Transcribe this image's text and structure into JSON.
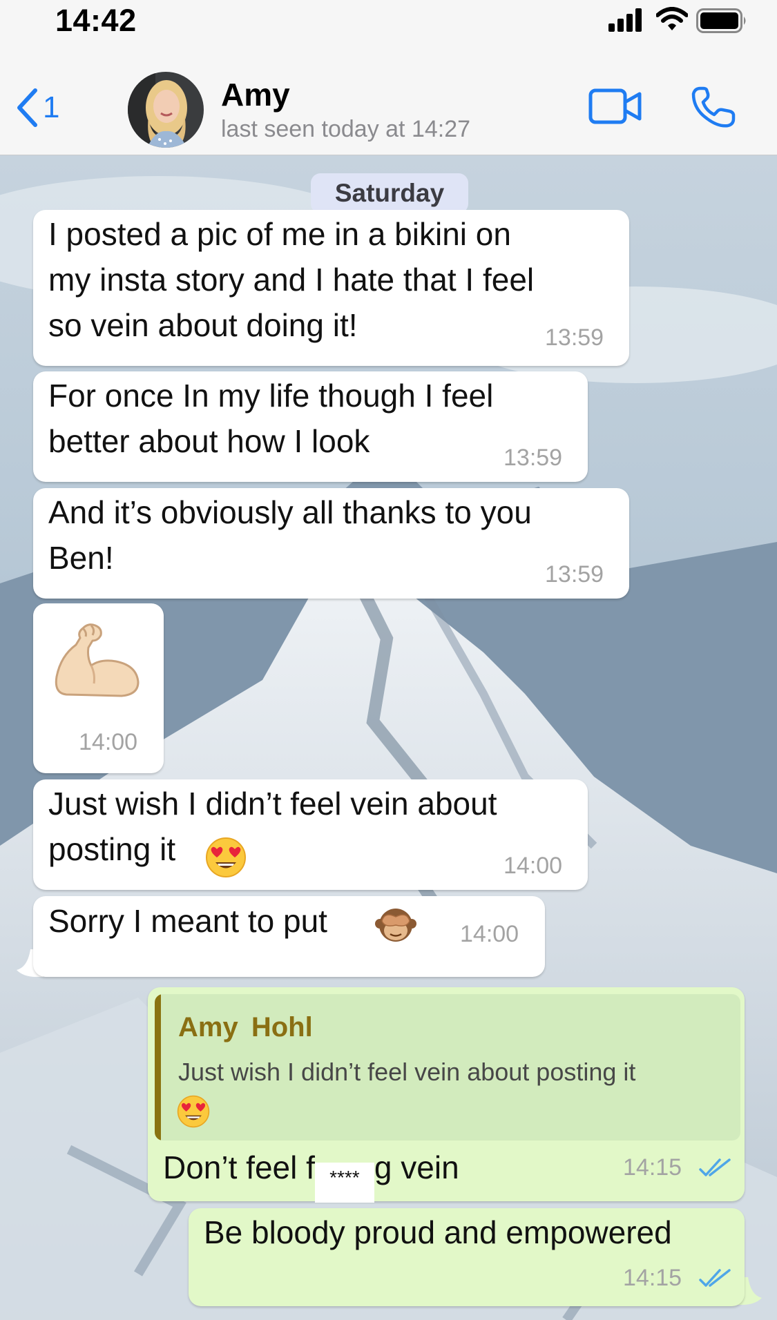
{
  "status_bar": {
    "time": "14:42"
  },
  "header": {
    "back_count": "1",
    "contact_name": "Amy",
    "last_seen": "last seen today at 14:27"
  },
  "chat": {
    "date_chip": "Saturday",
    "messages": [
      {
        "direction": "in",
        "text": "I posted a pic of me in a bikini on\nmy insta story and I hate that I feel\nso vein about doing it!",
        "time": "13:59"
      },
      {
        "direction": "in",
        "text": "For once In my life though I feel\nbetter about how I look",
        "time": "13:59"
      },
      {
        "direction": "in",
        "text": "And it’s obviously all thanks to you\nBen!",
        "time": "13:59"
      },
      {
        "direction": "in",
        "emoji": "flexed-biceps",
        "time": "14:00"
      },
      {
        "direction": "in",
        "text": "Just wish I didn’t feel vein about\nposting it",
        "emoji": "heart-eyes",
        "time": "14:00"
      },
      {
        "direction": "in",
        "text": "Sorry I meant to put",
        "emoji": "see-no-evil-monkey",
        "time": "14:00"
      },
      {
        "direction": "out",
        "reply_to": {
          "name": "Amy  Hohl",
          "text": "Just wish I didn’t feel vein about posting it",
          "emoji": "heart-eyes"
        },
        "text_start": "Don’t feel f",
        "censor": "****",
        "text_end": "g vein",
        "time": "14:15",
        "status": "read"
      },
      {
        "direction": "out",
        "text": "Be bloody proud and empowered",
        "time": "14:15",
        "status": "read"
      }
    ]
  },
  "colors": {
    "accent": "#1f7cf2",
    "incoming_bubble": "#ffffff",
    "outgoing_bubble": "#e2f8c8",
    "reply_name": "#8a6f13",
    "read_ticks": "#4fa6e8"
  }
}
